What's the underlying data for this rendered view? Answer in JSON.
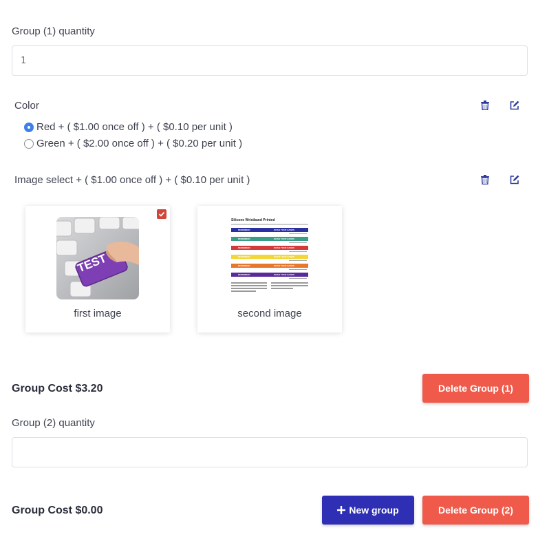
{
  "group1": {
    "quantity_label": "Group (1) quantity",
    "quantity_value": "1",
    "color_option": {
      "label": "Color",
      "choices": [
        {
          "label": "Red + ( $1.00 once off ) + ( $0.10 per unit )",
          "selected": true
        },
        {
          "label": "Green + ( $2.00 once off ) + ( $0.20 per unit )",
          "selected": false
        }
      ]
    },
    "image_option": {
      "label": "Image select + ( $1.00 once off ) + ( $0.10 per unit )",
      "images": [
        {
          "caption": "first image",
          "thumb_text": "TEST",
          "selected": true
        },
        {
          "caption": "second image",
          "selected": false,
          "doc_title": "Silicone Wristband Printed",
          "band_text_left": "REMEMBER",
          "band_text_right": "WASH YOUR HANDS",
          "band_colors": [
            "#2b2fa0",
            "#3a9e86",
            "#d53a3a",
            "#f2d63a",
            "#e8772e",
            "#5a2a9a"
          ]
        }
      ]
    },
    "cost_label": "Group Cost $3.20",
    "delete_label": "Delete Group (1)"
  },
  "group2": {
    "quantity_label": "Group (2) quantity",
    "quantity_value": "",
    "cost_label": "Group Cost $0.00",
    "new_group_label": "New group",
    "delete_label": "Delete Group (2)"
  },
  "colors": {
    "danger": "#ef5a4b",
    "primary": "#2e2fb5",
    "radio_accent": "#3e80e8",
    "icon": "#2e3a9e"
  },
  "icons": {
    "trash": "trash-icon",
    "edit": "edit-icon",
    "plus": "plus-icon",
    "check": "check-icon"
  }
}
